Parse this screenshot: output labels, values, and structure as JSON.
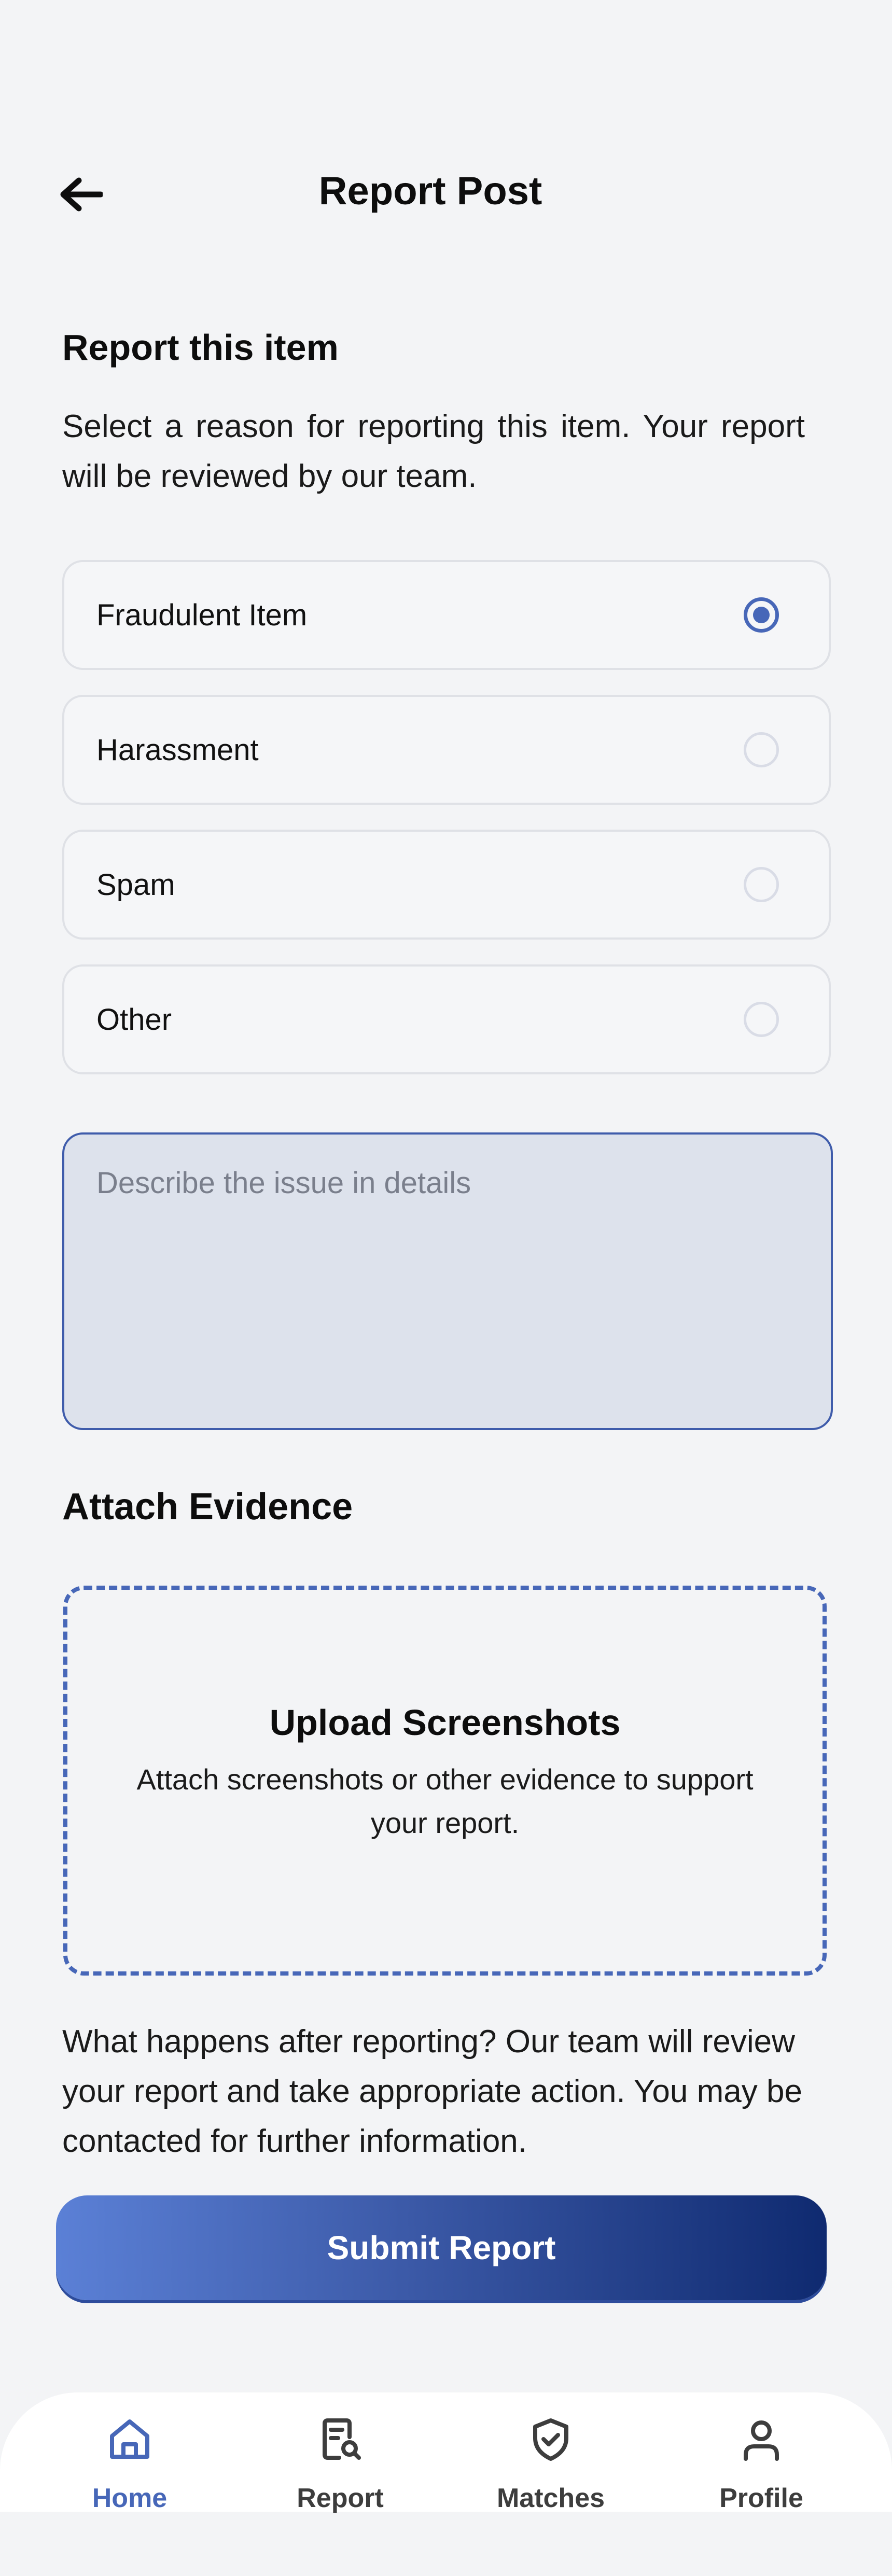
{
  "header": {
    "title": "Report Post",
    "back_icon": "arrow-left-icon"
  },
  "intro": {
    "heading": "Report this item",
    "description": "Select a reason for reporting this item. Your report will be reviewed by our team."
  },
  "reasons": {
    "selected": "Fraudulent Item",
    "items": [
      {
        "label": "Fraudulent Item",
        "selected": true
      },
      {
        "label": "Harassment",
        "selected": false
      },
      {
        "label": "Spam",
        "selected": false
      },
      {
        "label": "Other",
        "selected": false
      }
    ]
  },
  "details": {
    "placeholder": "Describe the issue in details",
    "value": ""
  },
  "evidence": {
    "heading": "Attach Evidence",
    "upload_title": "Upload Screenshots",
    "upload_description": "Attach screenshots or other evidence to support your report."
  },
  "info": {
    "text": "What happens after reporting? Our team will review your report and take appropriate action. You may be contacted for further information."
  },
  "submit": {
    "label": "Submit Report"
  },
  "bottom_nav": {
    "items": [
      {
        "label": "Home",
        "icon": "home-icon",
        "active": true
      },
      {
        "label": "Report",
        "icon": "report-search-icon",
        "active": false
      },
      {
        "label": "Matches",
        "icon": "shield-check-icon",
        "active": false
      },
      {
        "label": "Profile",
        "icon": "user-icon",
        "active": false
      }
    ]
  },
  "colors": {
    "accent": "#4767b8",
    "background": "#f3f4f6",
    "input_fill": "#dde2ec",
    "submit_gradient_start": "#5b80d6",
    "submit_gradient_end": "#0f2a70"
  }
}
